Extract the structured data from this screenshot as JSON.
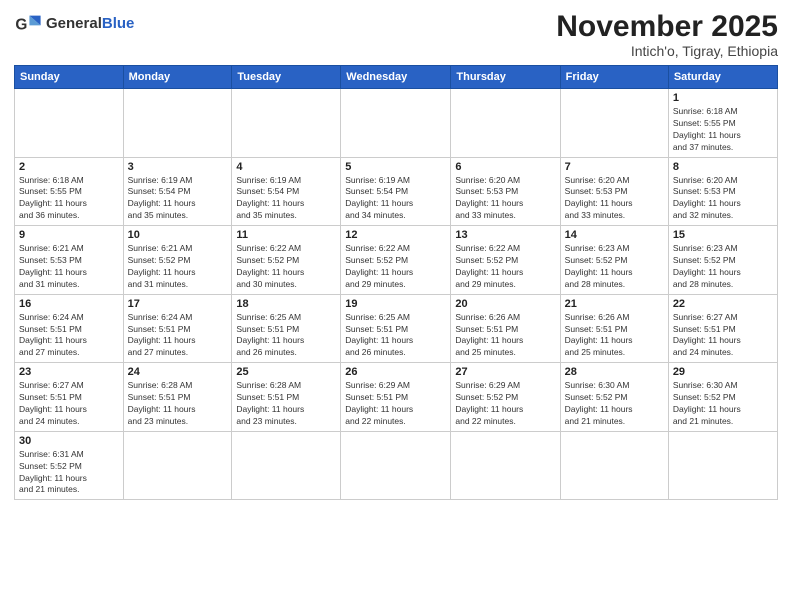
{
  "logo": {
    "general": "General",
    "blue": "Blue"
  },
  "header": {
    "month": "November 2025",
    "location": "Intich'o, Tigray, Ethiopia"
  },
  "weekdays": [
    "Sunday",
    "Monday",
    "Tuesday",
    "Wednesday",
    "Thursday",
    "Friday",
    "Saturday"
  ],
  "weeks": [
    [
      {
        "day": "",
        "info": ""
      },
      {
        "day": "",
        "info": ""
      },
      {
        "day": "",
        "info": ""
      },
      {
        "day": "",
        "info": ""
      },
      {
        "day": "",
        "info": ""
      },
      {
        "day": "",
        "info": ""
      },
      {
        "day": "1",
        "info": "Sunrise: 6:18 AM\nSunset: 5:55 PM\nDaylight: 11 hours\nand 37 minutes."
      }
    ],
    [
      {
        "day": "2",
        "info": "Sunrise: 6:18 AM\nSunset: 5:55 PM\nDaylight: 11 hours\nand 36 minutes."
      },
      {
        "day": "3",
        "info": "Sunrise: 6:19 AM\nSunset: 5:54 PM\nDaylight: 11 hours\nand 35 minutes."
      },
      {
        "day": "4",
        "info": "Sunrise: 6:19 AM\nSunset: 5:54 PM\nDaylight: 11 hours\nand 35 minutes."
      },
      {
        "day": "5",
        "info": "Sunrise: 6:19 AM\nSunset: 5:54 PM\nDaylight: 11 hours\nand 34 minutes."
      },
      {
        "day": "6",
        "info": "Sunrise: 6:20 AM\nSunset: 5:53 PM\nDaylight: 11 hours\nand 33 minutes."
      },
      {
        "day": "7",
        "info": "Sunrise: 6:20 AM\nSunset: 5:53 PM\nDaylight: 11 hours\nand 33 minutes."
      },
      {
        "day": "8",
        "info": "Sunrise: 6:20 AM\nSunset: 5:53 PM\nDaylight: 11 hours\nand 32 minutes."
      }
    ],
    [
      {
        "day": "9",
        "info": "Sunrise: 6:21 AM\nSunset: 5:53 PM\nDaylight: 11 hours\nand 31 minutes."
      },
      {
        "day": "10",
        "info": "Sunrise: 6:21 AM\nSunset: 5:52 PM\nDaylight: 11 hours\nand 31 minutes."
      },
      {
        "day": "11",
        "info": "Sunrise: 6:22 AM\nSunset: 5:52 PM\nDaylight: 11 hours\nand 30 minutes."
      },
      {
        "day": "12",
        "info": "Sunrise: 6:22 AM\nSunset: 5:52 PM\nDaylight: 11 hours\nand 29 minutes."
      },
      {
        "day": "13",
        "info": "Sunrise: 6:22 AM\nSunset: 5:52 PM\nDaylight: 11 hours\nand 29 minutes."
      },
      {
        "day": "14",
        "info": "Sunrise: 6:23 AM\nSunset: 5:52 PM\nDaylight: 11 hours\nand 28 minutes."
      },
      {
        "day": "15",
        "info": "Sunrise: 6:23 AM\nSunset: 5:52 PM\nDaylight: 11 hours\nand 28 minutes."
      }
    ],
    [
      {
        "day": "16",
        "info": "Sunrise: 6:24 AM\nSunset: 5:51 PM\nDaylight: 11 hours\nand 27 minutes."
      },
      {
        "day": "17",
        "info": "Sunrise: 6:24 AM\nSunset: 5:51 PM\nDaylight: 11 hours\nand 27 minutes."
      },
      {
        "day": "18",
        "info": "Sunrise: 6:25 AM\nSunset: 5:51 PM\nDaylight: 11 hours\nand 26 minutes."
      },
      {
        "day": "19",
        "info": "Sunrise: 6:25 AM\nSunset: 5:51 PM\nDaylight: 11 hours\nand 26 minutes."
      },
      {
        "day": "20",
        "info": "Sunrise: 6:26 AM\nSunset: 5:51 PM\nDaylight: 11 hours\nand 25 minutes."
      },
      {
        "day": "21",
        "info": "Sunrise: 6:26 AM\nSunset: 5:51 PM\nDaylight: 11 hours\nand 25 minutes."
      },
      {
        "day": "22",
        "info": "Sunrise: 6:27 AM\nSunset: 5:51 PM\nDaylight: 11 hours\nand 24 minutes."
      }
    ],
    [
      {
        "day": "23",
        "info": "Sunrise: 6:27 AM\nSunset: 5:51 PM\nDaylight: 11 hours\nand 24 minutes."
      },
      {
        "day": "24",
        "info": "Sunrise: 6:28 AM\nSunset: 5:51 PM\nDaylight: 11 hours\nand 23 minutes."
      },
      {
        "day": "25",
        "info": "Sunrise: 6:28 AM\nSunset: 5:51 PM\nDaylight: 11 hours\nand 23 minutes."
      },
      {
        "day": "26",
        "info": "Sunrise: 6:29 AM\nSunset: 5:51 PM\nDaylight: 11 hours\nand 22 minutes."
      },
      {
        "day": "27",
        "info": "Sunrise: 6:29 AM\nSunset: 5:52 PM\nDaylight: 11 hours\nand 22 minutes."
      },
      {
        "day": "28",
        "info": "Sunrise: 6:30 AM\nSunset: 5:52 PM\nDaylight: 11 hours\nand 21 minutes."
      },
      {
        "day": "29",
        "info": "Sunrise: 6:30 AM\nSunset: 5:52 PM\nDaylight: 11 hours\nand 21 minutes."
      }
    ],
    [
      {
        "day": "30",
        "info": "Sunrise: 6:31 AM\nSunset: 5:52 PM\nDaylight: 11 hours\nand 21 minutes."
      },
      {
        "day": "",
        "info": ""
      },
      {
        "day": "",
        "info": ""
      },
      {
        "day": "",
        "info": ""
      },
      {
        "day": "",
        "info": ""
      },
      {
        "day": "",
        "info": ""
      },
      {
        "day": "",
        "info": ""
      }
    ]
  ]
}
